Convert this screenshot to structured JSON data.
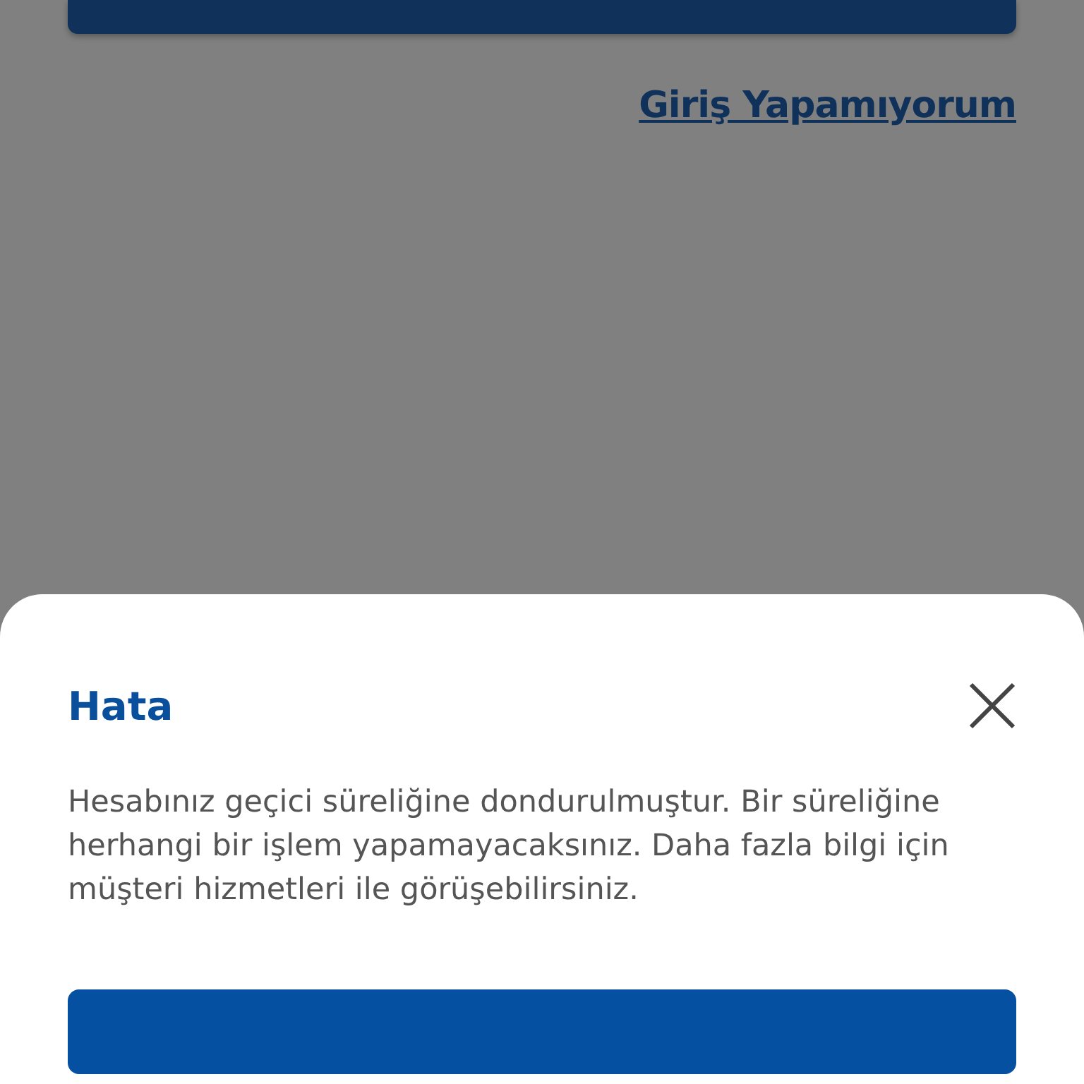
{
  "link": {
    "label": "Giriş Yapamıyorum"
  },
  "dialog": {
    "title": "Hata",
    "message": "Hesabınız geçici süreliğine dondurulmuştur. Bir süreliğine herhangi bir işlem yapamayacaksınız. Daha fazla bilgi için müşteri hizmetleri ile görüşebilirsiniz."
  }
}
